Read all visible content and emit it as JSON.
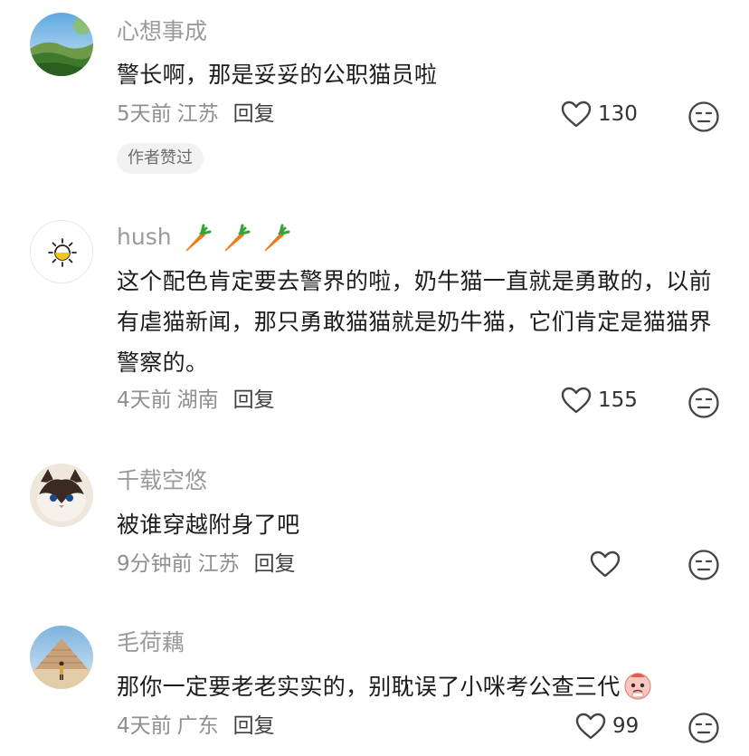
{
  "comments": [
    {
      "username": "心想事成",
      "content": "警长啊，那是妥妥的公职猫员啦",
      "time": "5天前",
      "location": "江苏",
      "reply_label": "回复",
      "likes": "130",
      "badge": "作者赞过",
      "avatar_icon": "landscape-avatar"
    },
    {
      "username": "hush",
      "username_emojis": [
        "carrot-icon",
        "carrot-icon",
        "carrot-icon"
      ],
      "content": "这个配色肯定要去警界的啦，奶牛猫一直就是勇敢的，以前有虐猫新闻，那只勇敢猫猫就是奶牛猫，它们肯定是猫猫界警察的。",
      "time": "4天前",
      "location": "湖南",
      "reply_label": "回复",
      "likes": "155",
      "avatar_icon": "sun-avatar"
    },
    {
      "username": "千载空悠",
      "content": "被谁穿越附身了吧",
      "time": "9分钟前",
      "location": "江苏",
      "reply_label": "回复",
      "likes": "",
      "avatar_icon": "cat-avatar"
    },
    {
      "username": "毛荷藕",
      "content": "那你一定要老老实实的，别耽误了小咪考公查三代",
      "content_emoji": "pleading-emoji",
      "time": "4天前",
      "location": "广东",
      "reply_label": "回复",
      "likes": "99",
      "avatar_icon": "pyramid-avatar"
    }
  ],
  "colors": {
    "username": "#9a9a9a",
    "meta": "#8f8f8f",
    "badge_bg": "#f2f2f2"
  }
}
